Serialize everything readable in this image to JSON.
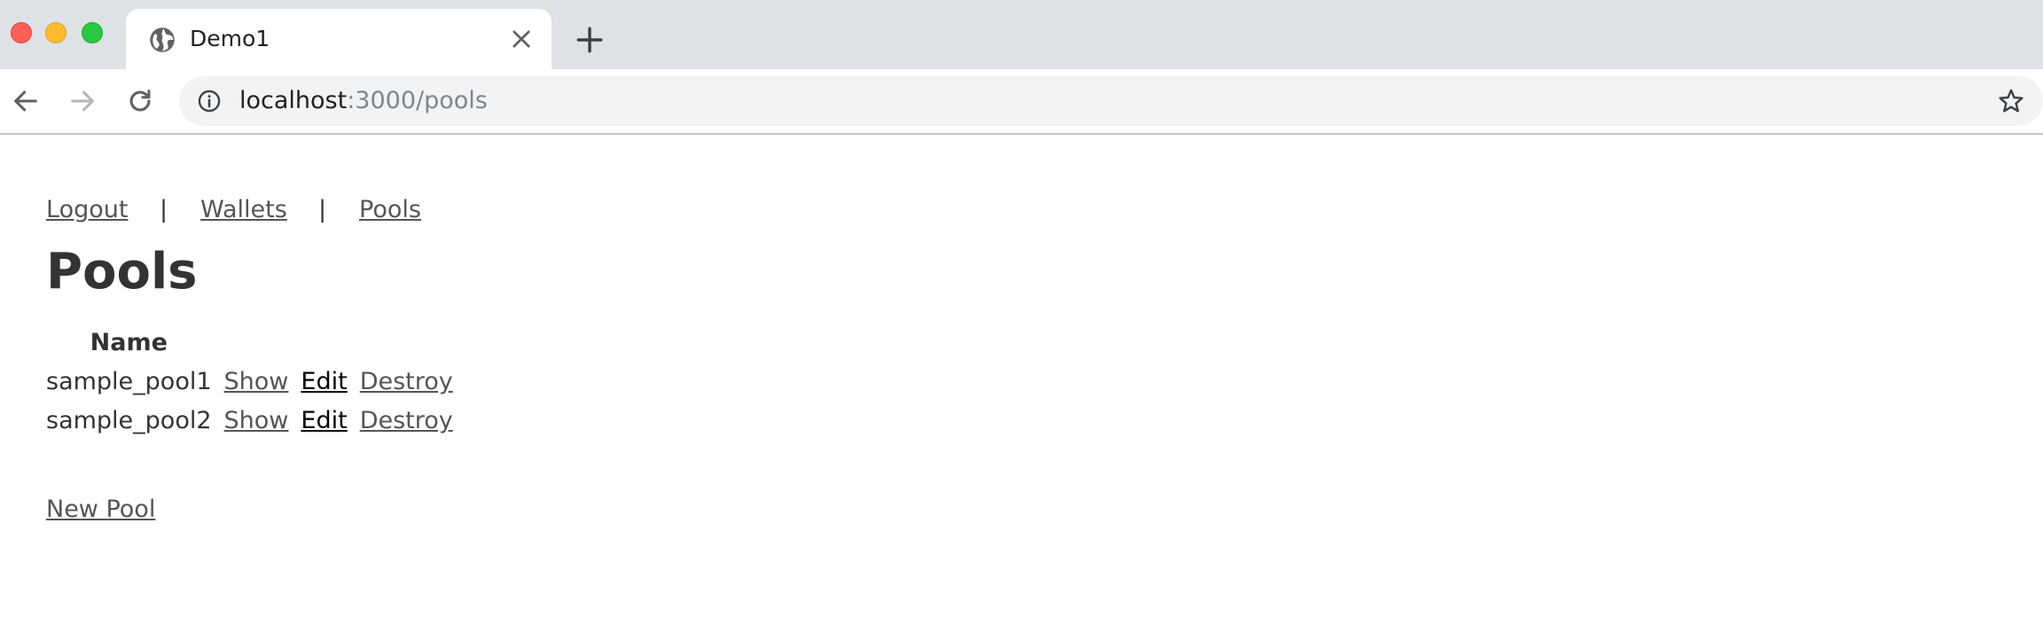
{
  "browser": {
    "tab": {
      "title": "Demo1",
      "icon": "globe-icon"
    },
    "address_bar": {
      "host": "localhost",
      "path": ":3000/pools"
    },
    "icons": {
      "back": "back-arrow-icon",
      "forward": "forward-arrow-icon",
      "reload": "reload-icon",
      "info": "info-icon",
      "bookmark": "star-icon",
      "new_tab": "plus-icon",
      "close_tab": "close-icon"
    },
    "colors": {
      "close": "#ff5f57",
      "minimize": "#febc2e",
      "maximize": "#28c840"
    }
  },
  "nav": {
    "logout": "Logout",
    "separator": "|",
    "wallets": "Wallets",
    "pools": "Pools"
  },
  "page": {
    "title": "Pools",
    "table": {
      "headers": [
        "Name"
      ],
      "rows": [
        {
          "name": "sample_pool1",
          "show": "Show",
          "edit": "Edit",
          "destroy": "Destroy"
        },
        {
          "name": "sample_pool2",
          "show": "Show",
          "edit": "Edit",
          "destroy": "Destroy"
        }
      ]
    },
    "new_pool": "New Pool"
  }
}
